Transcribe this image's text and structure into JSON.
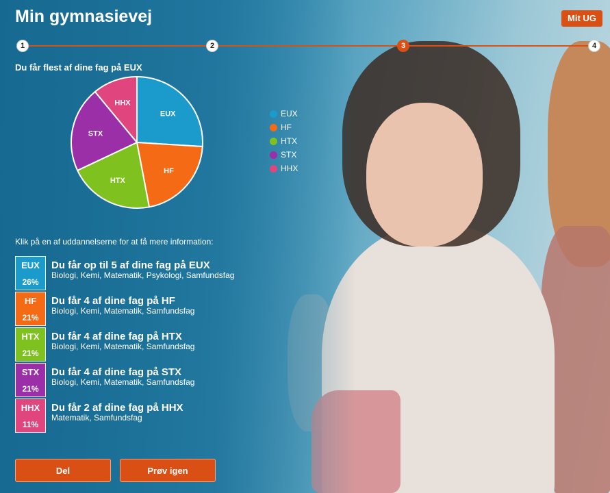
{
  "header": {
    "title": "Min gymnasievej",
    "mit_ug": "Mit UG"
  },
  "steps": [
    "1",
    "2",
    "3",
    "4"
  ],
  "active_step": 3,
  "chart_title": "Du får flest af dine fag på EUX",
  "chart_data": {
    "type": "pie",
    "categories": [
      "EUX",
      "HF",
      "HTX",
      "STX",
      "HHX"
    ],
    "values": [
      26,
      21,
      21,
      21,
      11
    ],
    "colors": [
      "#1a9bcb",
      "#f56a14",
      "#7fc11e",
      "#9a2fa8",
      "#e0457e"
    ],
    "legend_position": "right"
  },
  "instruction": "Klik på en af uddannelserne for at få mere information:",
  "educations": [
    {
      "code": "EUX",
      "percent": "26%",
      "heading": "Du får op til 5 af dine fag på EUX",
      "subjects": "Biologi, Kemi, Matematik, Psykologi, Samfundsfag",
      "color": "#1a9bcb"
    },
    {
      "code": "HF",
      "percent": "21%",
      "heading": "Du får 4 af dine fag på HF",
      "subjects": "Biologi, Kemi, Matematik, Samfundsfag",
      "color": "#f56a14"
    },
    {
      "code": "HTX",
      "percent": "21%",
      "heading": "Du får 4 af dine fag på HTX",
      "subjects": "Biologi, Kemi, Matematik, Samfundsfag",
      "color": "#7fc11e"
    },
    {
      "code": "STX",
      "percent": "21%",
      "heading": "Du får 4 af dine fag på STX",
      "subjects": "Biologi, Kemi, Matematik, Samfundsfag",
      "color": "#9a2fa8"
    },
    {
      "code": "HHX",
      "percent": "11%",
      "heading": "Du får 2 af dine fag på HHX",
      "subjects": "Matematik, Samfundsfag",
      "color": "#e0457e"
    }
  ],
  "buttons": {
    "share": "Del",
    "retry": "Prøv igen"
  }
}
